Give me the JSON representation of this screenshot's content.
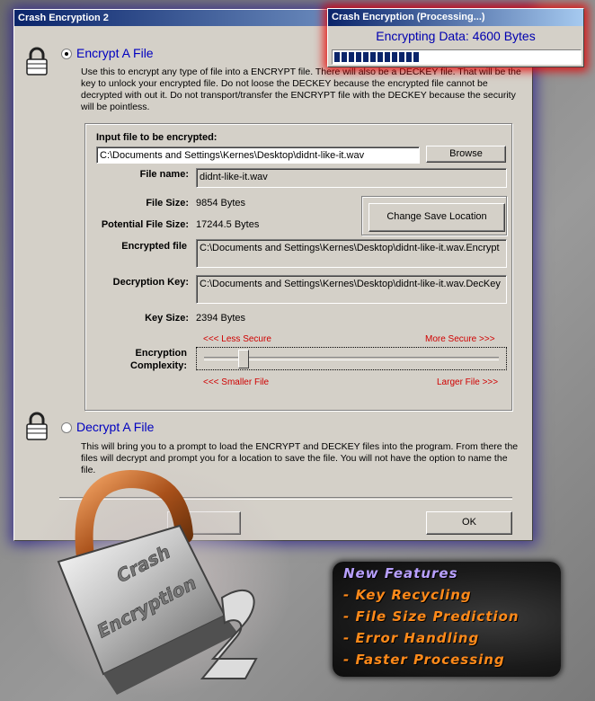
{
  "window": {
    "title": "Crash Encryption 2"
  },
  "popup": {
    "title": "Crash Encryption (Processing...)",
    "status": "Encrypting Data: 4600 Bytes",
    "progress_fraction": 0.38,
    "accent_color": "#0a246a"
  },
  "encrypt": {
    "heading": "Encrypt A File",
    "selected": true,
    "description": "Use this to encrypt any type of file into a ENCRYPT file. There will also be a DECKEY file. That will be the key to unlock your encrypted file. Do not loose the DECKEY because the encrypted file cannot be decrypted with out it. Do not transport/transfer the ENCRYPT file with the DECKEY because the security will be pointless.",
    "input_label": "Input file to be encrypted:",
    "input_value": "C:\\Documents and Settings\\Kernes\\Desktop\\didnt-like-it.wav",
    "browse_label": "Browse",
    "file_name_label": "File name:",
    "file_name_value": "didnt-like-it.wav",
    "file_size_label": "File Size:",
    "file_size_value": "9854 Bytes",
    "potential_size_label": "Potential File Size:",
    "potential_size_value": "17244.5 Bytes",
    "change_save_label": "Change Save Location",
    "encrypted_file_label": "Encrypted file",
    "encrypted_file_value": "C:\\Documents and Settings\\Kernes\\Desktop\\didnt-like-it.wav.Encrypt",
    "decryption_key_label": "Decryption Key:",
    "decryption_key_value": "C:\\Documents and Settings\\Kernes\\Desktop\\didnt-like-it.wav.DecKey",
    "key_size_label": "Key Size:",
    "key_size_value": "2394 Bytes",
    "less_secure": "<<< Less Secure",
    "more_secure": "More Secure >>>",
    "complexity_label_1": "Encryption",
    "complexity_label_2": "Complexity:",
    "complexity_fraction": 0.12,
    "smaller_file": "<<< Smaller File",
    "larger_file": "Larger File >>>"
  },
  "decrypt": {
    "heading": "Decrypt A File",
    "selected": false,
    "description": "This will bring you to a prompt to load the ENCRYPT and DECKEY files into the program. From there the files will decrypt and prompt you for a location to save the file. You will not have the option to name the file."
  },
  "footer": {
    "ok_label": "OK"
  },
  "logo": {
    "text_1": "Crash",
    "text_2": "Encryption",
    "number": "2"
  },
  "features": {
    "title": "New Features",
    "items": [
      "- Key Recycling",
      "- File Size Prediction",
      "- Error Handling",
      "- Faster Processing"
    ],
    "title_color": "#b8a0ff",
    "item_color": "#ff8a1a"
  }
}
